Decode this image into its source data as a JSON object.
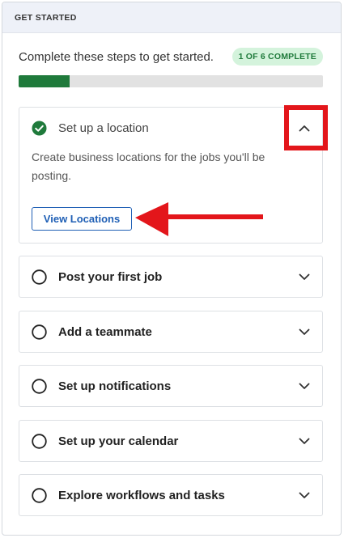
{
  "header": {
    "title": "GET STARTED"
  },
  "summary": {
    "text": "Complete these steps to get started.",
    "badge": "1 OF 6 COMPLETE",
    "completed": 1,
    "total": 6
  },
  "colors": {
    "progress": "#1f7a3b",
    "check": "#1f7a3b",
    "link": "#1f5fb5",
    "annotation": "#e3161b"
  },
  "steps": [
    {
      "title": "Set up a location",
      "status": "complete",
      "expanded": true,
      "description": "Create business locations for the jobs you'll be posting.",
      "button_label": "View Locations",
      "icon": "check-circle-icon",
      "toggle_icon": "chevron-up-icon"
    },
    {
      "title": "Post your first job",
      "status": "incomplete",
      "expanded": false,
      "icon": "empty-circle-icon",
      "toggle_icon": "chevron-down-icon"
    },
    {
      "title": "Add a teammate",
      "status": "incomplete",
      "expanded": false,
      "icon": "empty-circle-icon",
      "toggle_icon": "chevron-down-icon"
    },
    {
      "title": "Set up notifications",
      "status": "incomplete",
      "expanded": false,
      "icon": "empty-circle-icon",
      "toggle_icon": "chevron-down-icon"
    },
    {
      "title": "Set up your calendar",
      "status": "incomplete",
      "expanded": false,
      "icon": "empty-circle-icon",
      "toggle_icon": "chevron-down-icon"
    },
    {
      "title": "Explore workflows and tasks",
      "status": "incomplete",
      "expanded": false,
      "icon": "empty-circle-icon",
      "toggle_icon": "chevron-down-icon"
    }
  ]
}
